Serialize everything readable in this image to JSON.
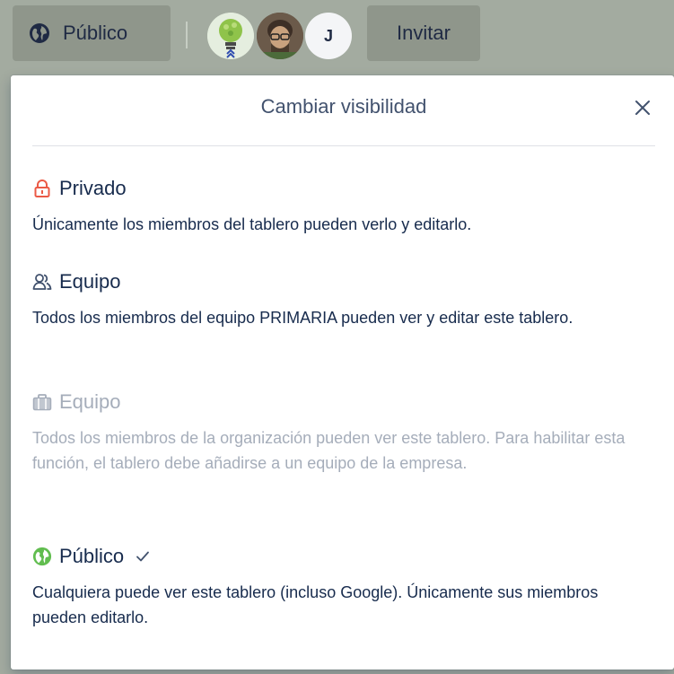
{
  "header": {
    "visibility_button_label": "Público",
    "avatars": [
      {
        "name": "calasbrud-logo-avatar",
        "initial": ""
      },
      {
        "name": "user-photo-avatar",
        "initial": ""
      },
      {
        "name": "user-initial-avatar",
        "initial": "J"
      }
    ],
    "invite_label": "Invitar"
  },
  "popover": {
    "title": "Cambiar visibilidad",
    "close_icon": "close-icon",
    "options": [
      {
        "name": "Privado",
        "icon": "lock-icon",
        "description": "Únicamente los miembros del tablero pueden verlo y editarlo.",
        "color": "#eb5a46",
        "disabled": false,
        "selected": false
      },
      {
        "name": "Equipo",
        "icon": "team-icon",
        "description": "Todos los miembros del equipo PRIMARIA pueden ver y editar este tablero.",
        "color": "#42526e",
        "disabled": false,
        "selected": false
      },
      {
        "name": "Equipo",
        "icon": "briefcase-icon",
        "description": "Todos los miembros de la organización pueden ver este tablero. Para habilitar esta función, el tablero debe añadirse a un equipo de la empresa.",
        "color": "#a5adba",
        "disabled": true,
        "selected": false
      },
      {
        "name": "Público",
        "icon": "globe-icon",
        "description": "Cualquiera puede ver este tablero (incluso Google). Únicamente sus miembros pueden editarlo.",
        "color": "#61bd4f",
        "disabled": false,
        "selected": true
      }
    ]
  },
  "colors": {
    "header_bg": "#a3aba0",
    "button_bg": "#8f968b",
    "text": "#172b4d",
    "muted": "#a5adba",
    "lock": "#eb5a46",
    "globe": "#61bd4f"
  }
}
